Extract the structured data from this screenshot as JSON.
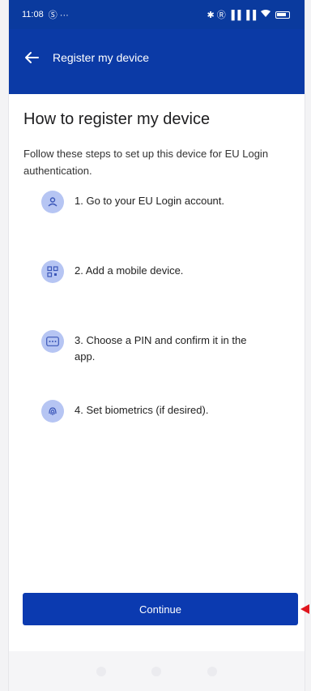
{
  "status_bar": {
    "time": "11:08",
    "left_icons": "Ⓢ ···",
    "right_icons": "✱ Ⓡ ▐▐ ▐▐",
    "battery": ""
  },
  "app_bar": {
    "title": "Register my device"
  },
  "main": {
    "title": "How to register my device",
    "intro": "Follow these steps to set up this device for EU Login authentication.",
    "steps": [
      {
        "icon": "account-icon",
        "text": "1. Go to your EU Login account."
      },
      {
        "icon": "qr-code-icon",
        "text": "2. Add a mobile device."
      },
      {
        "icon": "pin-icon",
        "text": "3. Choose a PIN and confirm it in the app."
      },
      {
        "icon": "fingerprint-icon",
        "text": "4. Set biometrics (if desired)."
      }
    ]
  },
  "footer": {
    "continue_label": "Continue"
  },
  "colors": {
    "header_blue": "#0b3aa6",
    "button_blue": "#0b3ab0",
    "icon_bg": "#b6c5f3",
    "annotation_red": "#e0161e"
  }
}
